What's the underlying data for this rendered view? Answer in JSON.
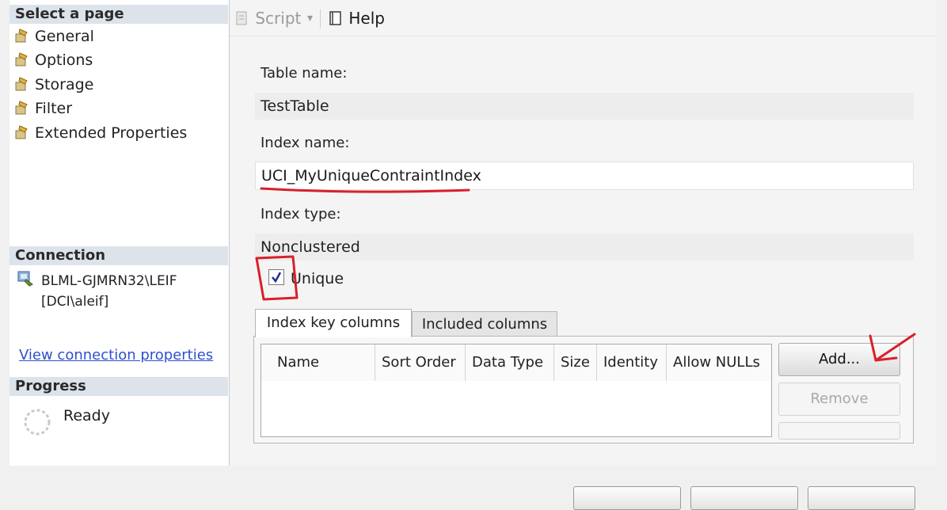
{
  "left_pane": {
    "select_page_header": "Select a page",
    "pages": [
      "General",
      "Options",
      "Storage",
      "Filter",
      "Extended Properties"
    ],
    "connection_header": "Connection",
    "server": "BLML-GJMRN32\\LEIF",
    "user": "[DCI\\aleif]",
    "view_connection_link": "View connection properties",
    "progress_header": "Progress",
    "progress_status": "Ready"
  },
  "toolbar": {
    "script_label": "Script",
    "help_label": "Help"
  },
  "form": {
    "table_name_label": "Table name:",
    "table_name_value": "TestTable",
    "index_name_label": "Index name:",
    "index_name_value": "UCI_MyUniqueContraintIndex",
    "index_type_label": "Index type:",
    "index_type_value": "Nonclustered",
    "unique_label": "Unique",
    "unique_checked": true
  },
  "tabs": [
    "Index key columns",
    "Included columns"
  ],
  "grid": {
    "columns": [
      "Name",
      "Sort Order",
      "Data Type",
      "Size",
      "Identity",
      "Allow NULLs"
    ]
  },
  "buttons": {
    "add": "Add...",
    "remove": "Remove"
  },
  "colors": {
    "annotation_red": "#d8202a",
    "link_blue": "#2f4fd1",
    "header_bg": "#dde3ea"
  }
}
